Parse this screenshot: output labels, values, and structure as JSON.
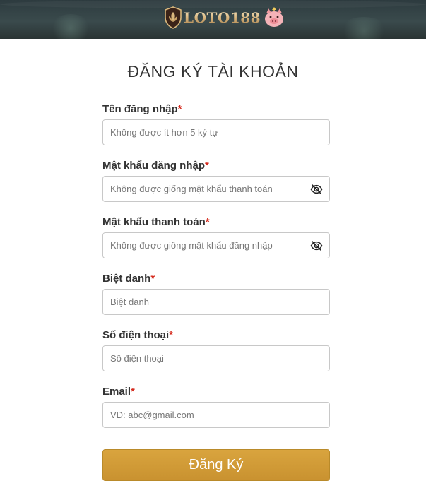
{
  "header": {
    "logo_text": "LOTO188",
    "logo_icon": "shield-emblem-icon",
    "mascot_icon": "pig-mascot-icon"
  },
  "title": "ĐĂNG KÝ TÀI KHOẢN",
  "form": {
    "fields": [
      {
        "label": "Tên đăng nhập",
        "required": "*",
        "placeholder": "Không được ít hơn 5 ký tự",
        "value": ""
      },
      {
        "label": "Mật khẩu đăng nhập",
        "required": "*",
        "placeholder": "Không được giống mật khẩu thanh toán",
        "value": "",
        "icon": "eye-hidden-icon"
      },
      {
        "label": "Mật khẩu thanh toán",
        "required": "*",
        "placeholder": "Không được giống mật khẩu đăng nhập",
        "value": "",
        "icon": "eye-hidden-icon"
      },
      {
        "label": "Biệt danh",
        "required": "*",
        "placeholder": "Biệt danh",
        "value": ""
      },
      {
        "label": "Số điện thoại",
        "required": "*",
        "placeholder": "Số điện thoại",
        "value": ""
      },
      {
        "label": "Email",
        "required": "*",
        "placeholder": "VD: abc@gmail.com",
        "value": ""
      }
    ],
    "submit_label": "Đăng Ký"
  },
  "colors": {
    "accent": "#d0993a",
    "required": "#d52b1e",
    "header_bg": "#33403f"
  }
}
